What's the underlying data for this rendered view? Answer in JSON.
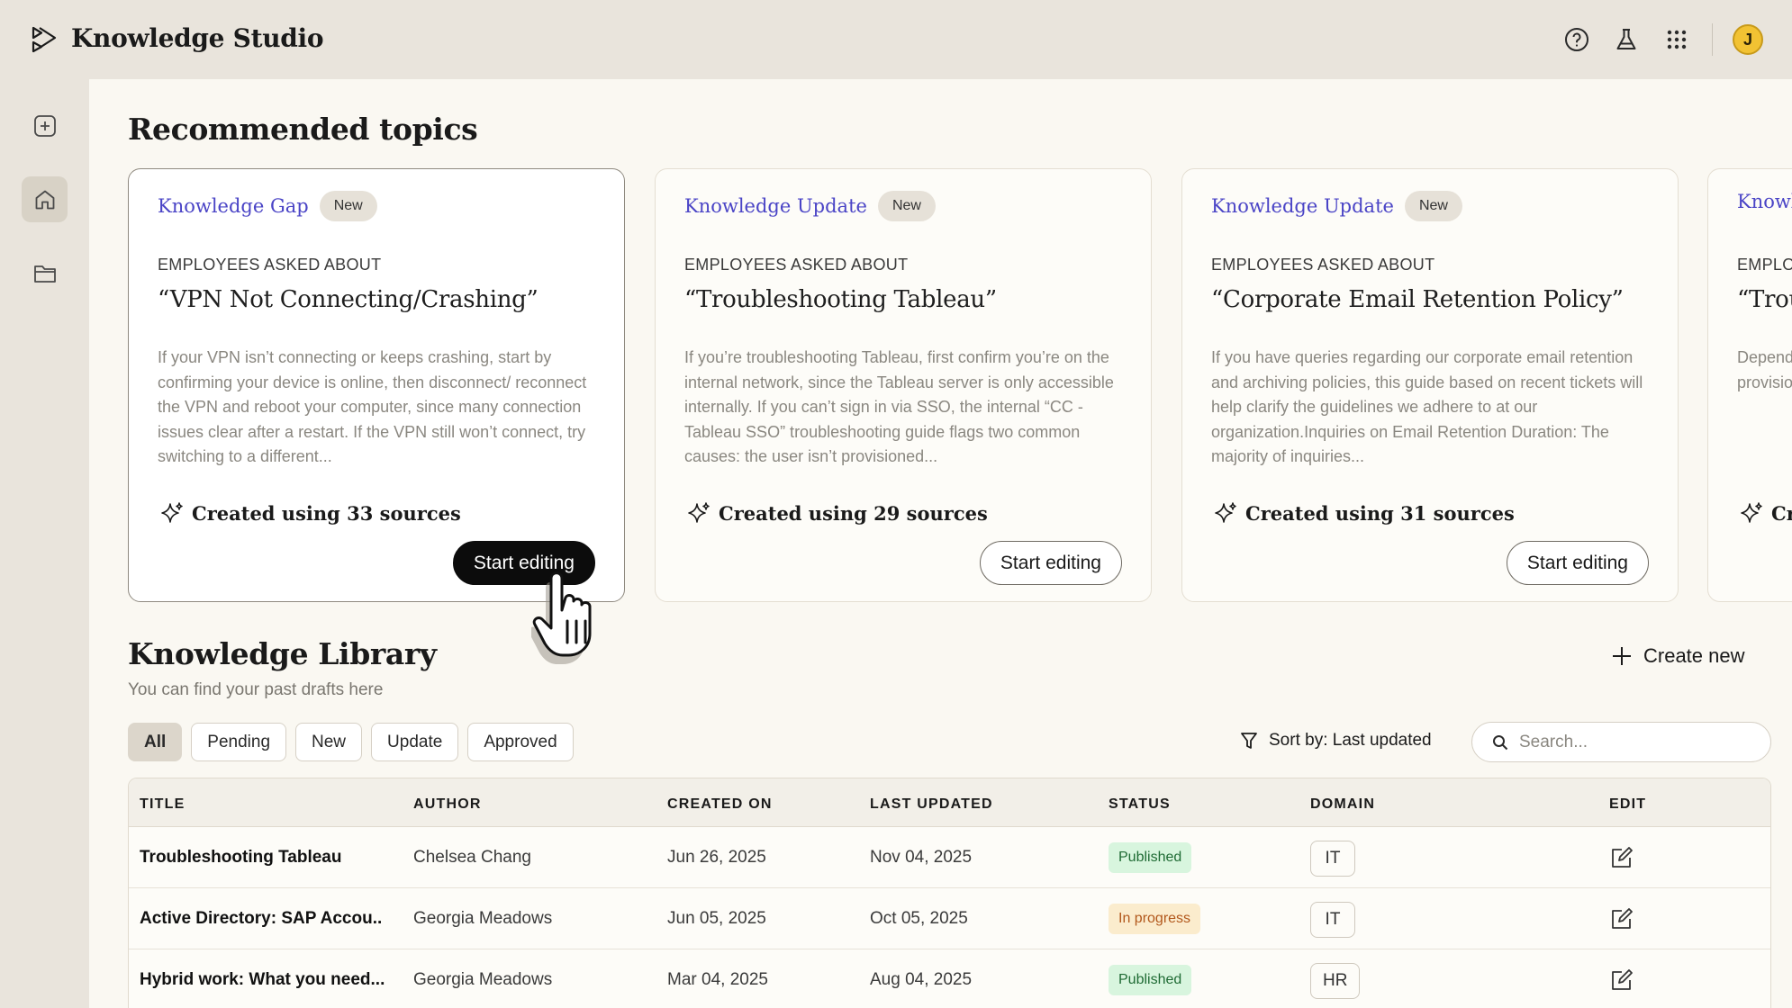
{
  "app": {
    "title": "Knowledge Studio",
    "avatar_initial": "J"
  },
  "topbar_icons": [
    "help-icon",
    "flask-icon",
    "apps-grid-icon"
  ],
  "sidebar": {
    "items": [
      {
        "name": "new-item",
        "icon": "plus-square-icon"
      },
      {
        "name": "home",
        "icon": "home-icon",
        "active": true
      },
      {
        "name": "folder",
        "icon": "folder-icon"
      }
    ]
  },
  "recommended": {
    "title": "Recommended topics",
    "cards": [
      {
        "type": "Knowledge Gap",
        "badge": "New",
        "eyebrow": "EMPLOYEES ASKED ABOUT",
        "question": "“VPN Not Connecting/Crashing”",
        "description": "If your VPN isn’t connecting or keeps crashing, start by confirming your device is online, then disconnect/ reconnect the VPN and reboot your computer, since many connection issues clear after a restart. If the VPN still won’t connect, try switching to a different...",
        "sources": "Created using 33 sources",
        "button": "Start editing"
      },
      {
        "type": "Knowledge Update",
        "badge": "New",
        "eyebrow": "EMPLOYEES ASKED ABOUT",
        "question": "“Troubleshooting Tableau”",
        "description": "If you’re troubleshooting Tableau, first confirm you’re on the internal network, since the Tableau server is only accessible internally. If you can’t sign in via SSO, the internal “CC - Tableau SSO” troubleshooting guide flags two common causes: the user isn’t provisioned...",
        "sources": "Created using 29 sources",
        "button": "Start editing"
      },
      {
        "type": "Knowledge Update",
        "badge": "New",
        "eyebrow": "EMPLOYEES ASKED ABOUT",
        "question": "“Corporate Email Retention Policy”",
        "description": "If you have queries regarding our corporate email retention and archiving policies, this guide based on recent tickets will help clarify the guidelines we adhere to at our organization.Inquiries on Email Retention Duration: The majority of inquiries...",
        "sources": "Created using 31 sources",
        "button": "Start editing"
      },
      {
        "type": "Knowledge Update",
        "badge": "",
        "eyebrow": "EMPLOYEES ASKED ABOUT",
        "question": "“Troubleshooting",
        "description": "Depending on your access level, some of the resources in provisioning. If you are...",
        "sources": "Created using",
        "button": ""
      }
    ]
  },
  "library": {
    "title": "Knowledge Library",
    "subtitle": "You can find your past drafts here",
    "create_label": "Create new",
    "filters": [
      "All",
      "Pending",
      "New",
      "Update",
      "Approved"
    ],
    "active_filter": "All",
    "sort_label": "Sort by: Last updated",
    "search_placeholder": "Search...",
    "columns": [
      "TITLE",
      "AUTHOR",
      "CREATED ON",
      "LAST UPDATED",
      "STATUS",
      "DOMAIN",
      "EDIT"
    ],
    "rows": [
      {
        "title": "Troubleshooting Tableau",
        "author": "Chelsea Chang",
        "created": "Jun 26, 2025",
        "updated": "Nov 04, 2025",
        "status": "Published",
        "domain": "IT"
      },
      {
        "title": "Active Directory: SAP Accou..",
        "author": "Georgia Meadows",
        "created": "Jun 05, 2025",
        "updated": "Oct 05, 2025",
        "status": "In progress",
        "domain": "IT"
      },
      {
        "title": "Hybrid work: What you need...",
        "author": "Georgia Meadows",
        "created": "Mar 04, 2025",
        "updated": "Aug 04, 2025",
        "status": "Published",
        "domain": "HR"
      }
    ]
  },
  "colors": {
    "accent": "#4a44c6",
    "published_bg": "#d8f5de",
    "progress_bg": "#fbeccd",
    "chrome": "#e9e4dc",
    "canvas": "#faf8f2"
  }
}
